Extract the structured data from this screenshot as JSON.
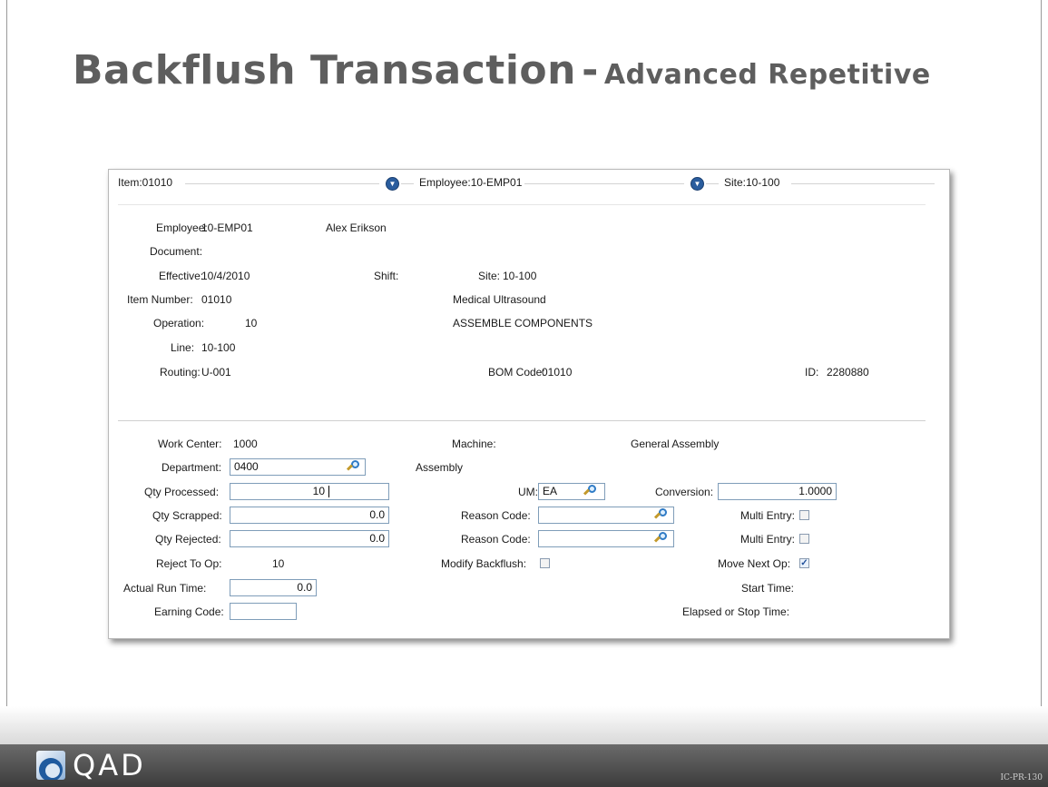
{
  "title": {
    "main": "Backflush Transaction",
    "separator": "-",
    "sub": "Advanced Repetitive"
  },
  "header_bar": {
    "item": "Item:01010",
    "employee": "Employee:10-EMP01",
    "site": "Site:10-100"
  },
  "info": {
    "employee_label": "Employee:",
    "employee_value": "10-EMP01",
    "employee_name": "Alex Erikson",
    "document_label": "Document:",
    "effective_label": "Effective:",
    "effective_value": "10/4/2010",
    "shift_label": "Shift:",
    "site_label": "Site:",
    "site_value": "10-100",
    "item_number_label": "Item Number:",
    "item_number_value": "01010",
    "item_desc": "Medical Ultrasound",
    "operation_label": "Operation:",
    "operation_value": "10",
    "operation_desc": "ASSEMBLE COMPONENTS",
    "line_label": "Line:",
    "line_value": "10-100",
    "routing_label": "Routing:",
    "routing_value": "U-001",
    "bom_label": "BOM Code:",
    "bom_value": "01010",
    "id_label": "ID:",
    "id_value": "2280880"
  },
  "form": {
    "work_center_label": "Work Center:",
    "work_center_value": "1000",
    "machine_label": "Machine:",
    "machine_desc": "General Assembly",
    "department_label": "Department:",
    "department_value": "0400",
    "department_desc": "Assembly",
    "qty_processed_label": "Qty Processed:",
    "qty_processed_value": "10",
    "um_label": "UM:",
    "um_value": "EA",
    "conversion_label": "Conversion:",
    "conversion_value": "1.0000",
    "qty_scrapped_label": "Qty Scrapped:",
    "qty_scrapped_value": "0.0",
    "reason_code_label_1": "Reason Code:",
    "reason_code_value_1": "",
    "multi_entry_label_1": "Multi Entry:",
    "multi_entry_1": false,
    "qty_rejected_label": "Qty Rejected:",
    "qty_rejected_value": "0.0",
    "reason_code_label_2": "Reason Code:",
    "reason_code_value_2": "",
    "multi_entry_label_2": "Multi Entry:",
    "multi_entry_2": false,
    "reject_to_op_label": "Reject To Op:",
    "reject_to_op_value": "10",
    "modify_backflush_label": "Modify Backflush:",
    "modify_backflush": false,
    "move_next_op_label": "Move Next Op:",
    "move_next_op": true,
    "actual_run_time_label": "Actual Run Time:",
    "actual_run_time_value": "0.0",
    "start_time_label": "Start Time:",
    "earning_code_label": "Earning Code:",
    "earning_code_value": "",
    "elapsed_label": "Elapsed or Stop Time:"
  },
  "footer": {
    "logo_text": "QAD",
    "slide_code": "IC-PR-130"
  },
  "icons": {
    "dropdown": "chevron-down-circle-icon",
    "lookup": "magnifier-icon",
    "check": "checkmark-icon"
  },
  "colors": {
    "title": "#5e5e5e",
    "footer": "#4a4a4a",
    "field_border": "#7f9db9",
    "icon_blue": "#2a5d9e"
  }
}
